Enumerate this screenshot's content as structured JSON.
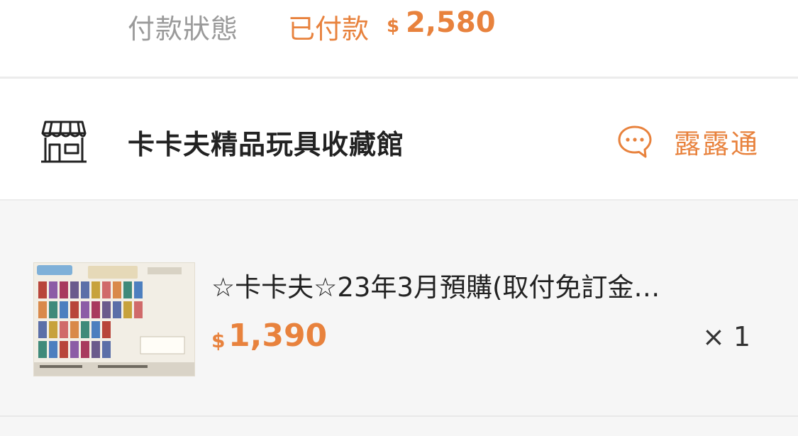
{
  "payment": {
    "label": "付款狀態",
    "status": "已付款",
    "currency": "$",
    "amount": "2,580"
  },
  "shop": {
    "icon": "store-icon",
    "name": "卡卡夫精品玩具收藏館",
    "chat_icon": "chat-bubble-icon",
    "chat_label": "露露通"
  },
  "item": {
    "title": "☆卡卡夫☆23年3月預購(取付免訂金…",
    "currency": "$",
    "price": "1,390",
    "quantity": "× 1",
    "thumbnail_icon": "product-thumbnail"
  },
  "colors": {
    "accent": "#e8823d",
    "text": "#222222",
    "muted": "#9a9a9a",
    "item_bg": "#f6f6f6"
  }
}
